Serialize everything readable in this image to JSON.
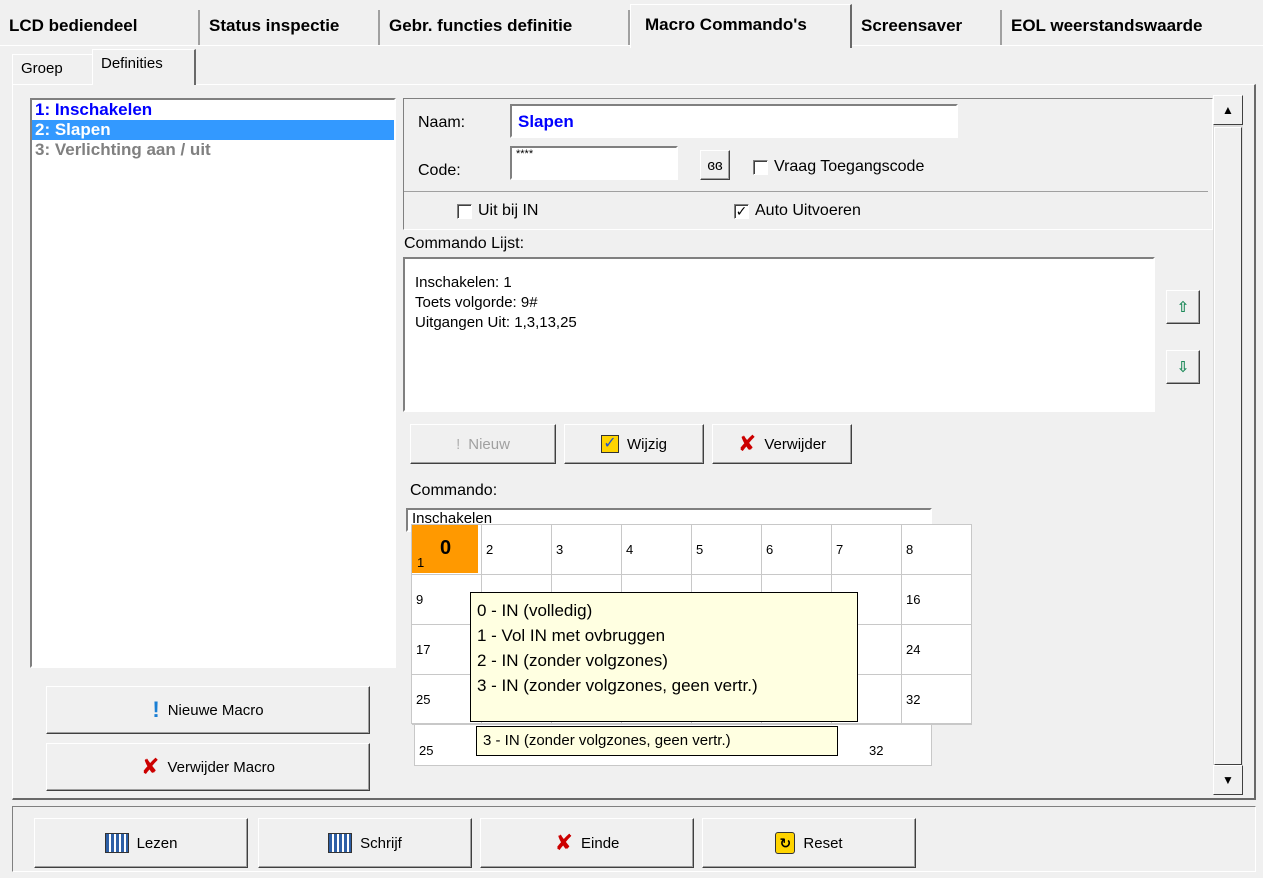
{
  "tabs": [
    {
      "label": "LCD bediendeel"
    },
    {
      "label": "Status inspectie"
    },
    {
      "label": "Gebr. functies definitie"
    },
    {
      "label": "Macro Commando's"
    },
    {
      "label": "Screensaver"
    },
    {
      "label": "EOL weerstandswaarde"
    }
  ],
  "subtabs": [
    {
      "label": "Groep"
    },
    {
      "label": "Definities"
    }
  ],
  "macros": [
    {
      "label": "1: Inschakelen",
      "color": "#0000ff"
    },
    {
      "label": "2: Slapen",
      "selected": true
    },
    {
      "label": "3: Verlichting aan / uit",
      "color": "#808080"
    }
  ],
  "macro_buttons": {
    "new": "Nieuwe Macro",
    "delete": "Verwijder Macro"
  },
  "form": {
    "name_label": "Naam:",
    "name_value": "Slapen",
    "code_label": "Code:",
    "code_value": "****",
    "ask_code_label": "Vraag Toegangscode",
    "off_at_in_label": "Uit bij IN",
    "auto_run_label": "Auto Uitvoeren",
    "auto_run_checked": true
  },
  "command_list": {
    "label": "Commando Lijst:",
    "lines": [
      "Inschakelen: 1",
      "Toets volgorde: 9#",
      "Uitgangen Uit: 1,3,13,25"
    ]
  },
  "cmd_buttons": {
    "new": "Nieuw",
    "edit": "Wijzig",
    "delete": "Verwijder"
  },
  "command": {
    "label": "Commando:",
    "value": "Inschakelen"
  },
  "grid": {
    "selected_value": "0",
    "rows": [
      [
        "1",
        "2",
        "3",
        "4",
        "5",
        "6",
        "7",
        "8"
      ],
      [
        "9",
        "",
        "",
        "",
        "",
        "",
        "",
        "16"
      ],
      [
        "17",
        "",
        "",
        "",
        "",
        "",
        "",
        "24"
      ],
      [
        "25",
        "",
        "",
        "",
        "",
        "",
        "",
        "32"
      ]
    ],
    "behind_row": [
      "25",
      "32"
    ]
  },
  "tooltip": {
    "lines": [
      "0 - IN (volledig)",
      "1 - Vol IN met ovbruggen",
      "2 - IN (zonder volgzones)",
      "3 - IN (zonder volgzones, geen vertr.)"
    ],
    "small": "3 - IN (zonder volgzones, geen vertr.)"
  },
  "bottom_buttons": {
    "read": "Lezen",
    "write": "Schrijf",
    "end": "Einde",
    "reset": "Reset"
  }
}
